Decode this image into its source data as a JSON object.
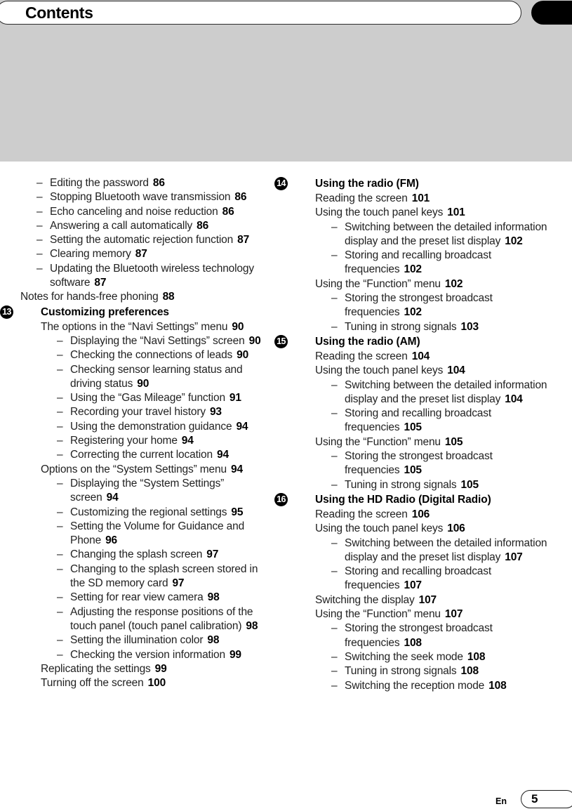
{
  "header": {
    "title": "Contents",
    "band_color": "#cdcdcd",
    "tab_color": "#000000"
  },
  "footer": {
    "language": "En",
    "page_number": "5"
  },
  "columns": [
    {
      "name": "left",
      "blocks": [
        {
          "type": "entries",
          "entries": [
            {
              "level": 2,
              "text": "Editing the password",
              "page": "86"
            },
            {
              "level": 2,
              "text": "Stopping Bluetooth wave transmission",
              "page": "86"
            },
            {
              "level": 2,
              "text": "Echo canceling and noise reduction",
              "page": "86"
            },
            {
              "level": 2,
              "text": "Answering a call automatically",
              "page": "86"
            },
            {
              "level": 2,
              "text": "Setting the automatic rejection function",
              "page": "87"
            },
            {
              "level": 2,
              "text": "Clearing memory",
              "page": "87"
            },
            {
              "level": 2,
              "text": "Updating the Bluetooth wireless technology software",
              "page": "87"
            },
            {
              "level": 1,
              "text": "Notes for hands-free phoning",
              "page": "88"
            }
          ]
        },
        {
          "type": "section",
          "badge": "13",
          "title": "Customizing preferences",
          "entries": [
            {
              "level": 1,
              "text": "The options in the “Navi Settings” menu",
              "page": "90"
            },
            {
              "level": 2,
              "text": "Displaying the “Navi Settings” screen",
              "page": "90"
            },
            {
              "level": 2,
              "text": "Checking the connections of leads",
              "page": "90"
            },
            {
              "level": 2,
              "text": "Checking sensor learning status and driving status",
              "page": "90"
            },
            {
              "level": 2,
              "text": "Using the “Gas Mileage” function",
              "page": "91"
            },
            {
              "level": 2,
              "text": "Recording your travel history",
              "page": "93"
            },
            {
              "level": 2,
              "text": "Using the demonstration guidance",
              "page": "94"
            },
            {
              "level": 2,
              "text": "Registering your home",
              "page": "94"
            },
            {
              "level": 2,
              "text": "Correcting the current location",
              "page": "94"
            },
            {
              "level": 1,
              "text": "Options on the “System Settings” menu",
              "page": "94"
            },
            {
              "level": 2,
              "text": "Displaying the “System Settings” screen",
              "page": "94"
            },
            {
              "level": 2,
              "text": "Customizing the regional settings",
              "page": "95"
            },
            {
              "level": 2,
              "text": "Setting the Volume for Guidance and Phone",
              "page": "96"
            },
            {
              "level": 2,
              "text": "Changing the splash screen",
              "page": "97"
            },
            {
              "level": 2,
              "text": "Changing to the splash screen stored in the SD memory card",
              "page": "97"
            },
            {
              "level": 2,
              "text": "Setting for rear view camera",
              "page": "98"
            },
            {
              "level": 2,
              "text": "Adjusting the response positions of the touch panel (touch panel calibration)",
              "page": "98"
            },
            {
              "level": 2,
              "text": "Setting the illumination color",
              "page": "98"
            },
            {
              "level": 2,
              "text": "Checking the version information",
              "page": "99"
            },
            {
              "level": 1,
              "text": "Replicating the settings",
              "page": "99"
            },
            {
              "level": 1,
              "text": "Turning off the screen",
              "page": "100"
            }
          ]
        }
      ]
    },
    {
      "name": "right",
      "blocks": [
        {
          "type": "section",
          "badge": "14",
          "title": "Using the radio (FM)",
          "entries": [
            {
              "level": 1,
              "text": "Reading the screen",
              "page": "101"
            },
            {
              "level": 1,
              "text": "Using the touch panel keys",
              "page": "101"
            },
            {
              "level": 2,
              "text": "Switching between the detailed information display and the preset list display",
              "page": "102"
            },
            {
              "level": 2,
              "text": "Storing and recalling broadcast frequencies",
              "page": "102"
            },
            {
              "level": 1,
              "text": "Using the “Function” menu",
              "page": "102"
            },
            {
              "level": 2,
              "text": "Storing the strongest broadcast frequencies",
              "page": "102"
            },
            {
              "level": 2,
              "text": "Tuning in strong signals",
              "page": "103"
            }
          ]
        },
        {
          "type": "section",
          "badge": "15",
          "title": "Using the radio (AM)",
          "entries": [
            {
              "level": 1,
              "text": "Reading the screen",
              "page": "104"
            },
            {
              "level": 1,
              "text": "Using the touch panel keys",
              "page": "104"
            },
            {
              "level": 2,
              "text": "Switching between the detailed information display and the preset list display",
              "page": "104"
            },
            {
              "level": 2,
              "text": "Storing and recalling broadcast frequencies",
              "page": "105"
            },
            {
              "level": 1,
              "text": "Using the “Function” menu",
              "page": "105"
            },
            {
              "level": 2,
              "text": "Storing the strongest broadcast frequencies",
              "page": "105"
            },
            {
              "level": 2,
              "text": "Tuning in strong signals",
              "page": "105"
            }
          ]
        },
        {
          "type": "section",
          "badge": "16",
          "title": "Using the HD Radio (Digital Radio)",
          "entries": [
            {
              "level": 1,
              "text": "Reading the screen",
              "page": "106"
            },
            {
              "level": 1,
              "text": "Using the touch panel keys",
              "page": "106"
            },
            {
              "level": 2,
              "text": "Switching between the detailed information display and the preset list display",
              "page": "107"
            },
            {
              "level": 2,
              "text": "Storing and recalling broadcast frequencies",
              "page": "107"
            },
            {
              "level": 1,
              "text": "Switching the display",
              "page": "107"
            },
            {
              "level": 1,
              "text": "Using the “Function” menu",
              "page": "107"
            },
            {
              "level": 2,
              "text": "Storing the strongest broadcast frequencies",
              "page": "108"
            },
            {
              "level": 2,
              "text": "Switching the seek mode",
              "page": "108"
            },
            {
              "level": 2,
              "text": "Tuning in strong signals",
              "page": "108"
            },
            {
              "level": 2,
              "text": "Switching the reception mode",
              "page": "108"
            }
          ]
        }
      ]
    }
  ]
}
